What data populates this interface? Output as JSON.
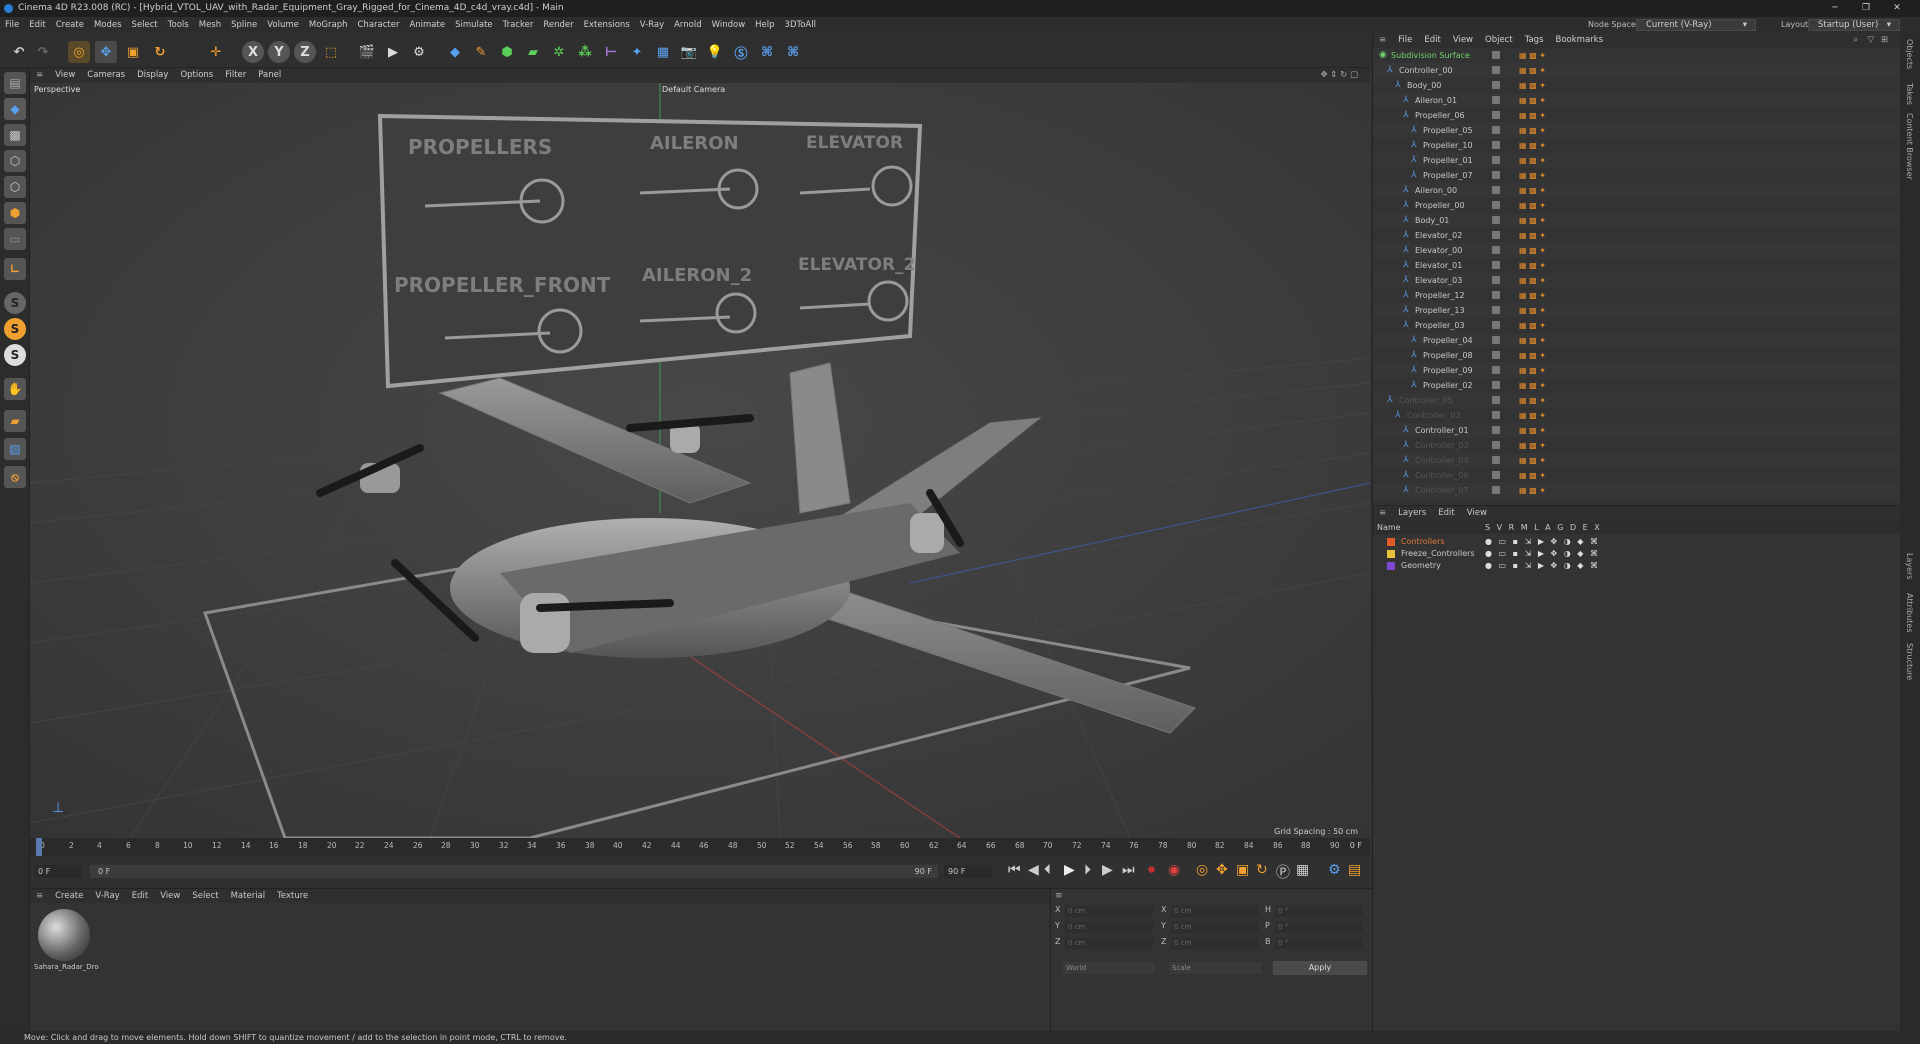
{
  "window": {
    "title": "Cinema 4D R23.008 (RC) - [Hybrid_VTOL_UAV_with_Radar_Equipment_Gray_Rigged_for_Cinema_4D_c4d_vray.c4d] - Main"
  },
  "menubar": {
    "items": [
      "File",
      "Edit",
      "Create",
      "Modes",
      "Select",
      "Tools",
      "Mesh",
      "Spline",
      "Volume",
      "MoGraph",
      "Character",
      "Animate",
      "Simulate",
      "Tracker",
      "Render",
      "Extensions",
      "V-Ray",
      "Arnold",
      "Window",
      "Help",
      "3DToAll"
    ],
    "node_space_label": "Node Space:",
    "node_space_value": "Current (V-Ray)",
    "layout_label": "Layout:",
    "layout_value": "Startup (User)"
  },
  "viewport": {
    "menu": [
      "View",
      "Cameras",
      "Display",
      "Options",
      "Filter",
      "Panel"
    ],
    "label": "Perspective",
    "camera": "Default Camera",
    "grid_spacing": "Grid Spacing : 50 cm",
    "controls": {
      "propellers": "PROPELLERS",
      "aileron": "AILERON",
      "elevator": "ELEVATOR",
      "propeller_front": "PROPELLER_FRONT",
      "aileron_2": "AILERON_2",
      "elevator_2": "ELEVATOR_2"
    }
  },
  "timeline": {
    "ticks": [
      "0",
      "2",
      "4",
      "6",
      "8",
      "10",
      "12",
      "14",
      "16",
      "18",
      "20",
      "22",
      "24",
      "26",
      "28",
      "30",
      "32",
      "34",
      "36",
      "38",
      "40",
      "42",
      "44",
      "46",
      "48",
      "50",
      "52",
      "54",
      "56",
      "58",
      "60",
      "62",
      "64",
      "66",
      "68",
      "70",
      "72",
      "74",
      "76",
      "78",
      "80",
      "82",
      "84",
      "86",
      "88",
      "90"
    ],
    "end_frame": "0 F"
  },
  "transport": {
    "start": "0 F",
    "current": "0 F",
    "end_a": "90 F",
    "end_b": "90 F"
  },
  "material_panel": {
    "menu": [
      "Create",
      "V-Ray",
      "Edit",
      "View",
      "Select",
      "Material",
      "Texture"
    ],
    "material_name": "Sahara_Radar_Dro"
  },
  "coord_panel": {
    "rows": [
      {
        "a": "X",
        "av": "0 cm",
        "b": "X",
        "bv": "0 cm",
        "c": "H",
        "cv": "0 °"
      },
      {
        "a": "Y",
        "av": "0 cm",
        "b": "Y",
        "bv": "0 cm",
        "c": "P",
        "cv": "0 °"
      },
      {
        "a": "Z",
        "av": "0 cm",
        "b": "Z",
        "bv": "0 cm",
        "c": "B",
        "cv": "0 °"
      }
    ],
    "world": "World",
    "scale": "Scale",
    "apply": "Apply"
  },
  "object_panel": {
    "menu": [
      "File",
      "Edit",
      "View",
      "Object",
      "Tags",
      "Bookmarks"
    ],
    "objects": [
      {
        "name": "Subdivision Surface",
        "indent": 0,
        "color": "#6fd36f"
      },
      {
        "name": "Controller_00",
        "indent": 1,
        "color": "#c8c8c8"
      },
      {
        "name": "Body_00",
        "indent": 2,
        "color": "#c8c8c8"
      },
      {
        "name": "Aileron_01",
        "indent": 3,
        "color": "#c8c8c8"
      },
      {
        "name": "Propeller_06",
        "indent": 3,
        "color": "#c8c8c8"
      },
      {
        "name": "Propeller_05",
        "indent": 4,
        "color": "#c8c8c8"
      },
      {
        "name": "Propeller_10",
        "indent": 4,
        "color": "#c8c8c8"
      },
      {
        "name": "Propeller_01",
        "indent": 4,
        "color": "#c8c8c8"
      },
      {
        "name": "Propeller_07",
        "indent": 4,
        "color": "#c8c8c8"
      },
      {
        "name": "Aileron_00",
        "indent": 3,
        "color": "#c8c8c8"
      },
      {
        "name": "Propeller_00",
        "indent": 3,
        "color": "#c8c8c8"
      },
      {
        "name": "Body_01",
        "indent": 3,
        "color": "#c8c8c8"
      },
      {
        "name": "Elevator_02",
        "indent": 3,
        "color": "#c8c8c8"
      },
      {
        "name": "Elevator_00",
        "indent": 3,
        "color": "#c8c8c8"
      },
      {
        "name": "Elevator_01",
        "indent": 3,
        "color": "#c8c8c8"
      },
      {
        "name": "Elevator_03",
        "indent": 3,
        "color": "#c8c8c8"
      },
      {
        "name": "Propeller_12",
        "indent": 3,
        "color": "#c8c8c8"
      },
      {
        "name": "Propeller_13",
        "indent": 3,
        "color": "#c8c8c8"
      },
      {
        "name": "Propeller_03",
        "indent": 3,
        "color": "#c8c8c8"
      },
      {
        "name": "Propeller_04",
        "indent": 4,
        "color": "#c8c8c8"
      },
      {
        "name": "Propeller_08",
        "indent": 4,
        "color": "#c8c8c8"
      },
      {
        "name": "Propeller_09",
        "indent": 4,
        "color": "#c8c8c8"
      },
      {
        "name": "Propeller_02",
        "indent": 4,
        "color": "#c8c8c8"
      },
      {
        "name": "Controller_05",
        "indent": 1,
        "color": "#555555"
      },
      {
        "name": "Controller_02",
        "indent": 2,
        "color": "#555555"
      },
      {
        "name": "Controller_01",
        "indent": 3,
        "color": "#c8c8c8"
      },
      {
        "name": "Controller_03",
        "indent": 3,
        "color": "#555555"
      },
      {
        "name": "Controller_04",
        "indent": 3,
        "color": "#555555"
      },
      {
        "name": "Controller_06",
        "indent": 3,
        "color": "#555555"
      },
      {
        "name": "Controller_07",
        "indent": 3,
        "color": "#555555"
      }
    ]
  },
  "layer_panel": {
    "menu": [
      "Layers",
      "Edit",
      "View"
    ],
    "header": {
      "name": "Name",
      "cols": "S V R M L A G D E X"
    },
    "layers": [
      {
        "name": "Controllers",
        "color": "#e05a2a",
        "text": "#e07a3a"
      },
      {
        "name": "Freeze_Controllers",
        "color": "#e8c23a",
        "text": "#c8c8c8"
      },
      {
        "name": "Geometry",
        "color": "#7a4ad0",
        "text": "#c8c8c8"
      }
    ]
  },
  "right_strip": [
    "Objects",
    "Takes",
    "Content Browser",
    "Layers",
    "Attributes",
    "Structure"
  ],
  "status": {
    "text": "Move: Click and drag to move elements. Hold down SHIFT to quantize movement / add to the selection in point mode, CTRL to remove."
  }
}
